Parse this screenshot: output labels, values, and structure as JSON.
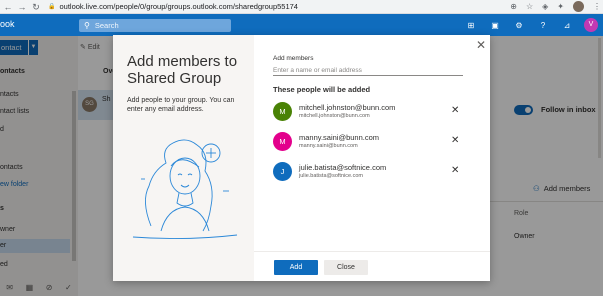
{
  "browser": {
    "url": "outlook.live.com/people/0/group/groups.outlook.com/sharedgroup55174"
  },
  "header": {
    "logo_text": "ook",
    "search_placeholder": "Search",
    "avatar_initial": "V",
    "colors": {
      "brand": "#0f6cbd",
      "avatar": "#c239b3"
    }
  },
  "leftnav": {
    "new_contact_label": "ontact",
    "items": [
      {
        "label": "ontacts"
      },
      {
        "label": "ntacts"
      },
      {
        "label": "ntact lists"
      },
      {
        "label": "d"
      },
      {
        "label": "ontacts"
      },
      {
        "label": "ew folder"
      },
      {
        "label": "s"
      },
      {
        "label": "wner"
      },
      {
        "label": "er"
      },
      {
        "label": "ed"
      }
    ]
  },
  "middle": {
    "edit_label": "Edit",
    "overview_label": "Ove",
    "group_initials": "SG",
    "group_name": "Sh"
  },
  "right": {
    "follow_label": "Follow in inbox",
    "add_members_label": "Add members",
    "role_header": "Role",
    "owner_value": "Owner"
  },
  "dialog": {
    "title": "Add members to Shared Group",
    "description": "Add people to your group. You can enter any email address.",
    "input_label": "Add members",
    "input_placeholder": "Enter a name or email address",
    "people_header": "These people will be added",
    "people": [
      {
        "initial": "M",
        "name": "mitchell.johnston@bunn.com",
        "email": "mitchell.johnston@bunn.com",
        "color": "#498205"
      },
      {
        "initial": "M",
        "name": "manny.saini@bunn.com",
        "email": "manny.saini@bunn.com",
        "color": "#e3008c"
      },
      {
        "initial": "J",
        "name": "julie.batista@softnice.com",
        "email": "julie.batista@softnice.com",
        "color": "#0f6cbd"
      }
    ],
    "add_button": "Add",
    "close_button": "Close"
  }
}
